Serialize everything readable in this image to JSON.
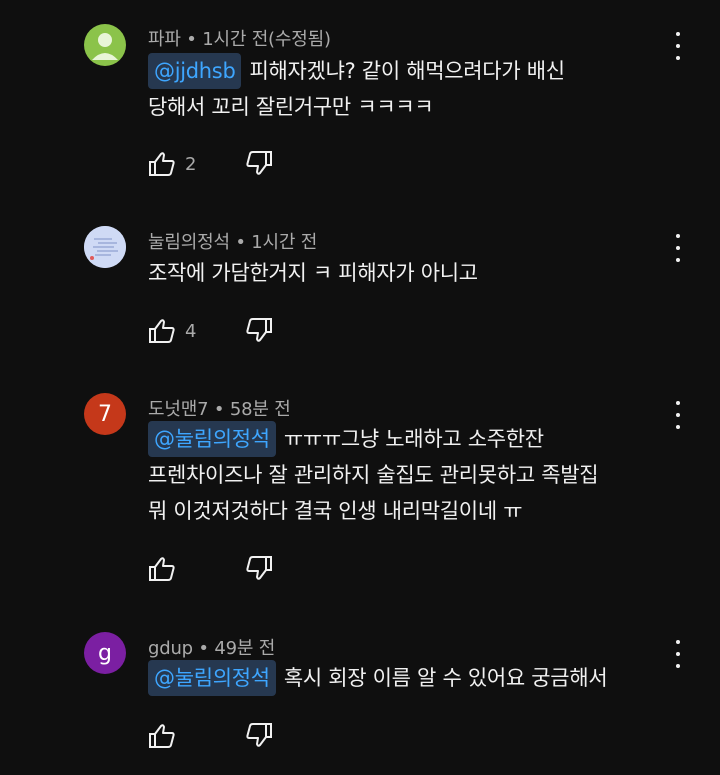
{
  "comments": [
    {
      "author": "파파",
      "time": "1시간 전(수정됨)",
      "mention": "@jjdhsb",
      "lines": [
        "피해자겠냐? 같이 해먹으려다가 배신",
        "당해서 꼬리 잘린거구만 ㅋㅋㅋㅋ"
      ],
      "likes": "2",
      "avatar_icon": "person-silhouette-icon",
      "avatar_color": "#8bc34a"
    },
    {
      "author": "눌림의정석",
      "time": "1시간 전",
      "mention": "",
      "lines": [
        "조작에 가담한거지 ㅋ 피해자가 아니고"
      ],
      "likes": "4",
      "avatar_icon": "photo-avatar",
      "avatar_color": "#c7d4f2"
    },
    {
      "author": "도넛맨7",
      "time": "58분 전",
      "mention": "@눌림의정석",
      "lines": [
        "ㅠㅠㅠ그냥 노래하고 소주한잔",
        "프렌차이즈나 잘 관리하지 술집도 관리못하고 족발집",
        "뭐 이것저것하다 결국 인생 내리막길이네 ㅠ"
      ],
      "likes": "",
      "avatar_letter": "7",
      "avatar_color": "#c5381a"
    },
    {
      "author": "gdup",
      "time": "49분 전",
      "mention": "@눌림의정석",
      "lines": [
        "혹시 회장 이름 알 수 있어요 궁금해서"
      ],
      "likes": "",
      "avatar_letter": "g",
      "avatar_color": "#7b1fa2"
    }
  ],
  "meta_separator": " • ",
  "icons": {
    "like": "thumbs-up-icon",
    "dislike": "thumbs-down-icon",
    "menu": "more-vert-icon"
  },
  "colors": {
    "background": "#0f0f0f",
    "mention_text": "#3ea6ff",
    "mention_bg": "#263850",
    "secondary_text": "#aaaaaa"
  }
}
